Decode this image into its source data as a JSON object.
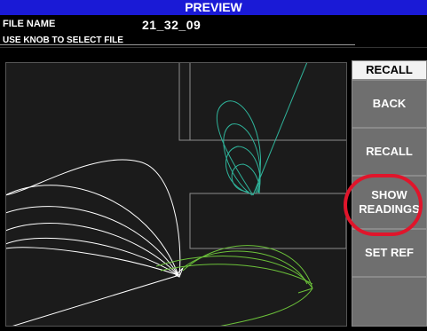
{
  "header": {
    "title": "PREVIEW"
  },
  "file": {
    "label": "FILE NAME",
    "value": "21_32_09",
    "hint": "USE KNOB TO SELECT FILE"
  },
  "sidebar": {
    "title": "RECALL",
    "buttons": [
      {
        "label": "BACK"
      },
      {
        "label": "RECALL"
      },
      {
        "label": "SHOW READINGS"
      },
      {
        "label": "SET REF"
      },
      {
        "label": ""
      }
    ]
  },
  "colors": {
    "accent": "#1a1ad6",
    "trace_white": "#ffffff",
    "trace_green": "#6cc23a",
    "trace_teal": "#2fb39a",
    "highlight": "#e0152b"
  }
}
